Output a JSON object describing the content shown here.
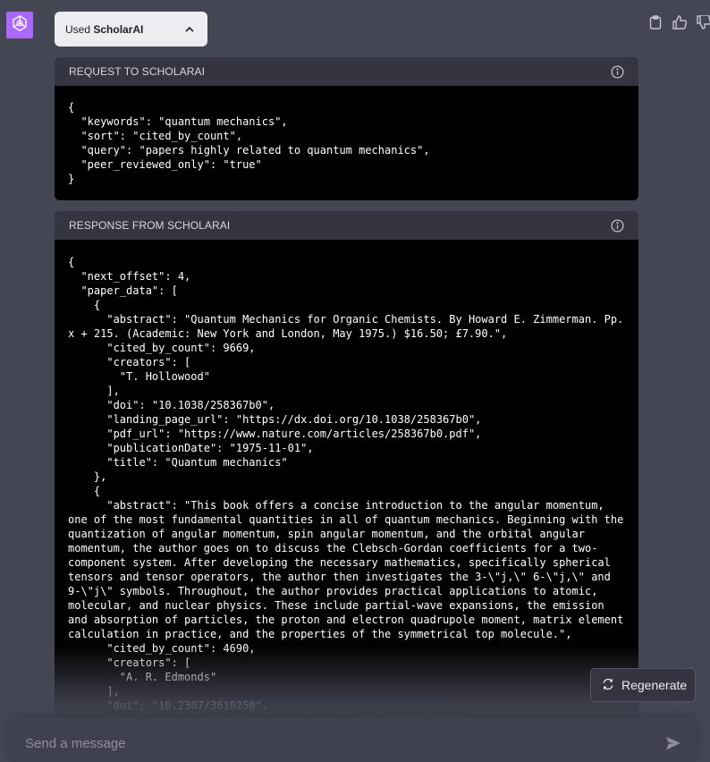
{
  "plugin_chip": {
    "prefix": "Used ",
    "plugin": "ScholarAI"
  },
  "request": {
    "title": "REQUEST TO SCHOLARAI",
    "body": "{\n  \"keywords\": \"quantum mechanics\",\n  \"sort\": \"cited_by_count\",\n  \"query\": \"papers highly related to quantum mechanics\",\n  \"peer_reviewed_only\": \"true\"\n}"
  },
  "response": {
    "title": "RESPONSE FROM SCHOLARAI",
    "body": "{\n  \"next_offset\": 4,\n  \"paper_data\": [\n    {\n      \"abstract\": \"Quantum Mechanics for Organic Chemists. By Howard E. Zimmerman. Pp. x + 215. (Academic: New York and London, May 1975.) $16.50; £7.90.\",\n      \"cited_by_count\": 9669,\n      \"creators\": [\n        \"T. Hollowood\"\n      ],\n      \"doi\": \"10.1038/258367b0\",\n      \"landing_page_url\": \"https://dx.doi.org/10.1038/258367b0\",\n      \"pdf_url\": \"https://www.nature.com/articles/258367b0.pdf\",\n      \"publicationDate\": \"1975-11-01\",\n      \"title\": \"Quantum mechanics\"\n    },\n    {\n      \"abstract\": \"This book offers a concise introduction to the angular momentum, one of the most fundamental quantities in all of quantum mechanics. Beginning with the quantization of angular momentum, spin angular momentum, and the orbital angular momentum, the author goes on to discuss the Clebsch-Gordan coefficients for a two-component system. After developing the necessary mathematics, specifically spherical tensors and tensor operators, the author then investigates the 3-\\\"j,\\\" 6-\\\"j,\\\" and 9-\\\"j\\\" symbols. Throughout, the author provides practical applications to atomic, molecular, and nuclear physics. These include partial-wave expansions, the emission and absorption of particles, the proton and electron quadrupole moment, matrix element calculation in practice, and the properties of the symmetrical top molecule.\",\n      \"cited_by_count\": 4690,\n      \"creators\": [\n        \"A. R. Edmonds\"\n      ],\n      \"doi\": \"10.2307/3610250\",\n      \"landing_page_url\": \"https://dx.doi.org/10.2307/3610250\","
  },
  "regenerate_label": "Regenerate",
  "composer": {
    "placeholder": "Send a message"
  },
  "icons": {
    "avatar": "openai-logo-icon",
    "copy": "clipboard-icon",
    "like": "thumbs-up-icon",
    "dislike": "thumbs-down-icon",
    "info": "info-icon",
    "regenerate": "refresh-icon",
    "send": "send-icon",
    "chip": "chevron-up-icon"
  },
  "colors": {
    "avatar_bg": "#ab68ff",
    "page_bg": "#444654",
    "code_bg": "#000000"
  }
}
